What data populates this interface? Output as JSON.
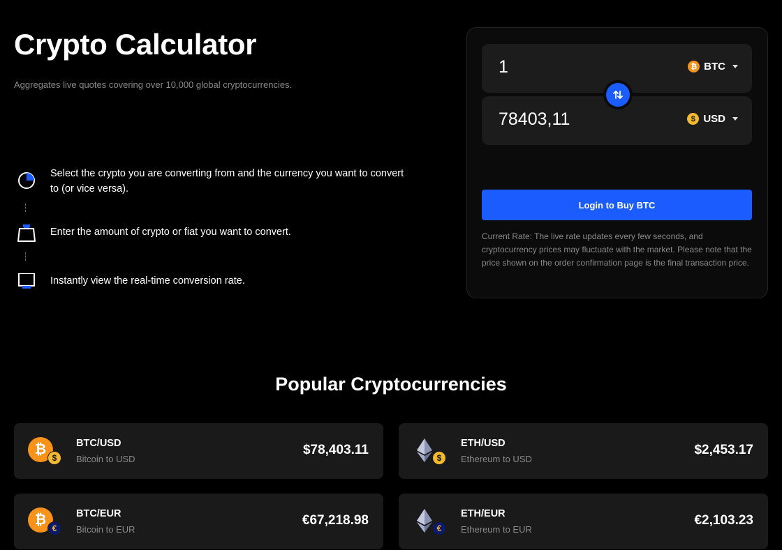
{
  "header": {
    "title": "Crypto Calculator",
    "subtitle": "Aggregates live quotes covering over 10,000 global cryptocurrencies."
  },
  "steps": [
    {
      "icon": "pie-chart-icon",
      "text": "Select the crypto you are converting from and the currency you want to convert to (or vice versa)."
    },
    {
      "icon": "shopping-bag-icon",
      "text": "Enter the amount of crypto or fiat you want to convert."
    },
    {
      "icon": "monitor-icon",
      "text": "Instantly view the real-time conversion rate."
    }
  ],
  "converter": {
    "from": {
      "amount": "1",
      "currency": "BTC",
      "coin_symbol": "₿"
    },
    "to": {
      "amount": "78403,11",
      "currency": "USD",
      "coin_symbol": "$"
    },
    "buy_button": "Login to Buy BTC",
    "rate_note": "Current Rate: The live rate updates every few seconds, and cryptocurrency prices may fluctuate with the market. Please note that the price shown on the order confirmation page is the final transaction price."
  },
  "popular": {
    "title": "Popular Cryptocurrencies",
    "cards": [
      {
        "pair": "BTC/USD",
        "desc": "Bitcoin to USD",
        "price": "$78,403.11",
        "coin": "bitcoin",
        "fiat": "usd"
      },
      {
        "pair": "ETH/USD",
        "desc": "Ethereum to USD",
        "price": "$2,453.17",
        "coin": "ethereum",
        "fiat": "usd"
      },
      {
        "pair": "BTC/EUR",
        "desc": "Bitcoin to EUR",
        "price": "€67,218.98",
        "coin": "bitcoin",
        "fiat": "eur"
      },
      {
        "pair": "ETH/EUR",
        "desc": "Ethereum to EUR",
        "price": "€2,103.23",
        "coin": "ethereum",
        "fiat": "eur"
      }
    ]
  },
  "colors": {
    "accent": "#1a5cff",
    "bitcoin": "#f7931a",
    "usd": "#f3ba2f",
    "eur": "#0b1a6b",
    "card_bg": "#1a1a1a"
  }
}
